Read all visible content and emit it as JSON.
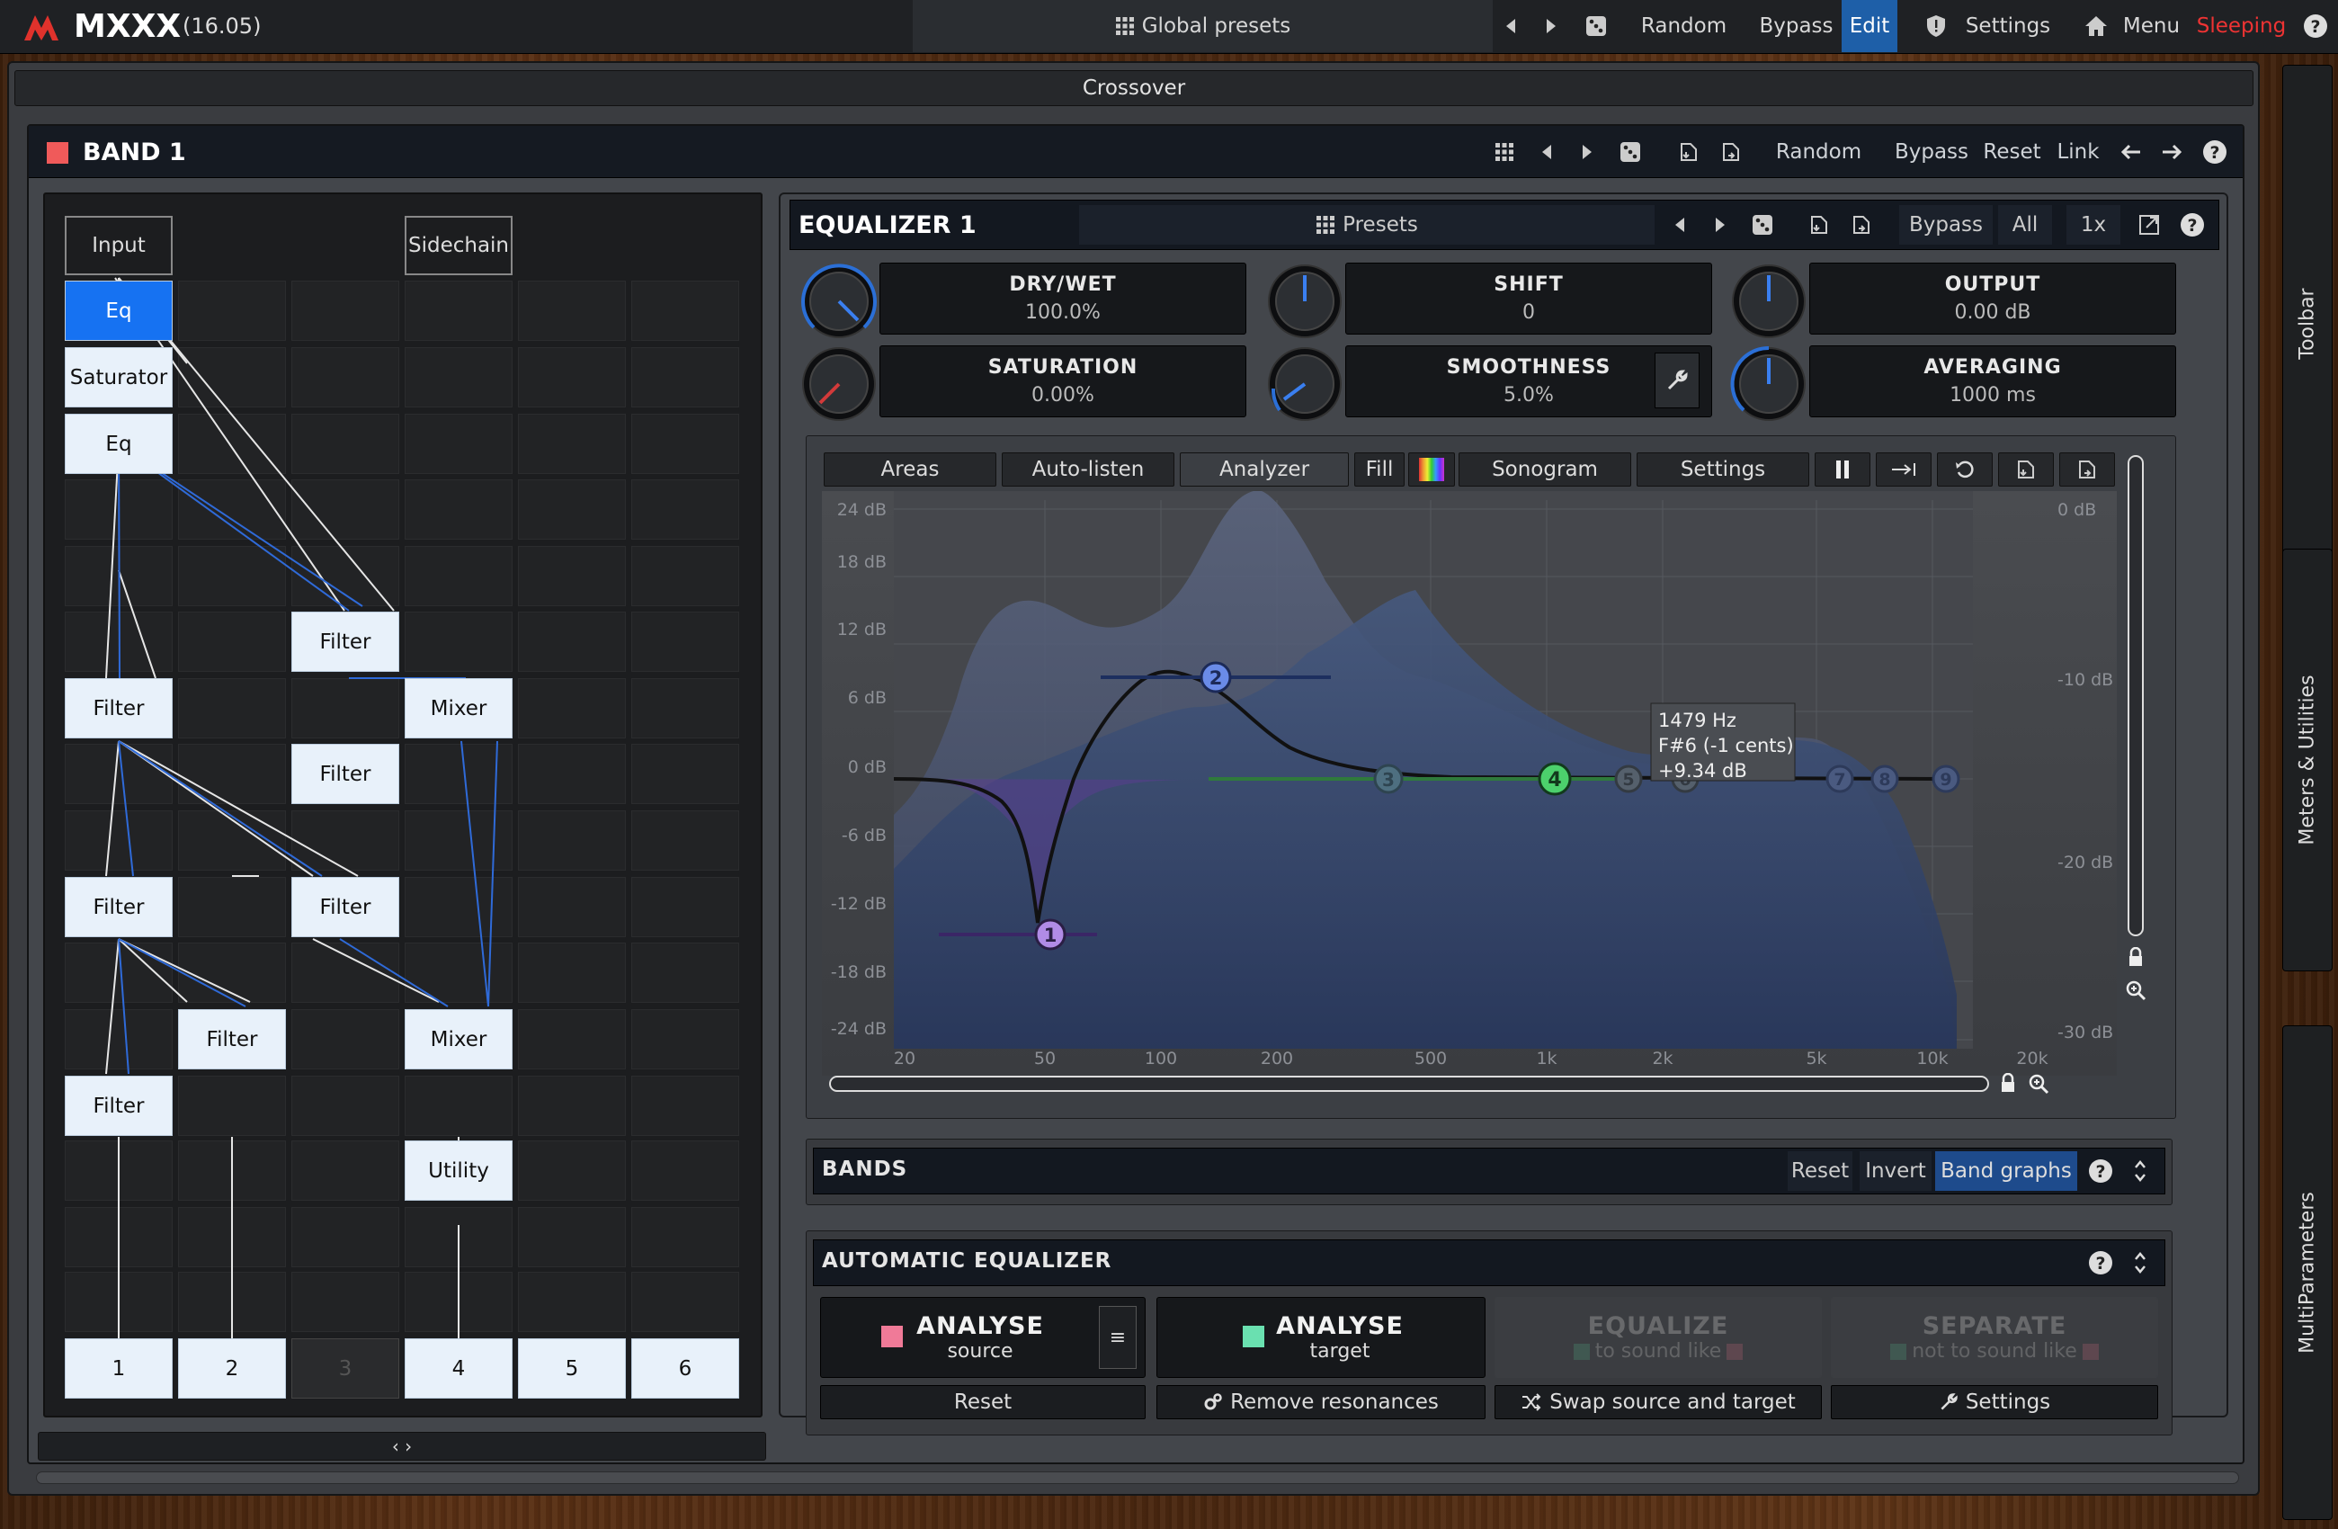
{
  "app": {
    "name": "MXXX",
    "version": "(16.05)"
  },
  "topbar": {
    "global_presets": "Global presets",
    "random": "Random",
    "bypass": "Bypass",
    "edit": "Edit",
    "settings": "Settings",
    "menu": "Menu",
    "sleeping": "Sleeping",
    "help": "?"
  },
  "crossover": "Crossover",
  "band": {
    "title": "BAND 1",
    "color": "#f05a5a",
    "random": "Random",
    "bypass": "Bypass",
    "reset": "Reset",
    "link": "Link",
    "help": "?"
  },
  "routing": {
    "input": "Input",
    "sidechain": "Sidechain",
    "nodes": {
      "eq1": "Eq",
      "saturator": "Saturator",
      "eq2": "Eq",
      "filter_a": "Filter",
      "filter_b": "Filter",
      "mixer_a": "Mixer",
      "filter_c": "Filter",
      "filter_d": "Filter",
      "filter_e": "Filter",
      "filter_f": "Filter",
      "mixer_b": "Mixer",
      "filter_g": "Filter",
      "utility": "Utility"
    },
    "outputs": [
      "1",
      "2",
      "3",
      "4",
      "5",
      "6"
    ],
    "expand": "‹ ›"
  },
  "eq": {
    "title": "EQUALIZER 1",
    "presets": "Presets",
    "bypass": "Bypass",
    "all": "All",
    "oversampling": "1x",
    "help": "?",
    "params": {
      "drywet": {
        "label": "DRY/WET",
        "value": "100.0%"
      },
      "shift": {
        "label": "SHIFT",
        "value": "0"
      },
      "output": {
        "label": "OUTPUT",
        "value": "0.00 dB"
      },
      "saturation": {
        "label": "SATURATION",
        "value": "0.00%"
      },
      "smoothness": {
        "label": "SMOOTHNESS",
        "value": "5.0%"
      },
      "averaging": {
        "label": "AVERAGING",
        "value": "1000 ms"
      }
    },
    "graph_toolbar": {
      "areas": "Areas",
      "autolisten": "Auto-listen",
      "analyzer": "Analyzer",
      "fill": "Fill",
      "sonogram": "Sonogram",
      "settings": "Settings"
    },
    "y_labels_left": [
      "24 dB",
      "18 dB",
      "12 dB",
      "6 dB",
      "0 dB",
      "-6 dB",
      "-12 dB",
      "-18 dB",
      "-24 dB"
    ],
    "y_labels_right": [
      "0 dB",
      "-10 dB",
      "-20 dB",
      "-30 dB"
    ],
    "x_labels": [
      "20",
      "50",
      "100",
      "200",
      "500",
      "1k",
      "2k",
      "5k",
      "10k",
      "20k"
    ],
    "tooltip": {
      "freq": "1479 Hz",
      "note": "F#6 (-1 cents)",
      "gain": "+9.34 dB"
    },
    "band_points": [
      "1",
      "2",
      "3",
      "4",
      "5",
      "6",
      "7",
      "8",
      "9"
    ]
  },
  "bands": {
    "title": "BANDS",
    "reset": "Reset",
    "invert": "Invert",
    "band_graphs": "Band graphs",
    "help": "?"
  },
  "auto_eq": {
    "title": "AUTOMATIC EQUALIZER",
    "help": "?",
    "analyse_source": {
      "title": "ANALYSE",
      "sub": "source"
    },
    "analyse_target": {
      "title": "ANALYSE",
      "sub": "target"
    },
    "equalize": {
      "title": "EQUALIZE",
      "sub": "to sound like"
    },
    "separate": {
      "title": "SEPARATE",
      "sub": "not to sound like"
    },
    "menu_glyph": "≡",
    "reset": "Reset",
    "remove_resonances": "Remove resonances",
    "swap": "Swap source and target",
    "settings": "Settings"
  },
  "side_tabs": {
    "toolbar": "Toolbar",
    "meters": "Meters & Utilities",
    "multiparams": "MultiParameters"
  }
}
